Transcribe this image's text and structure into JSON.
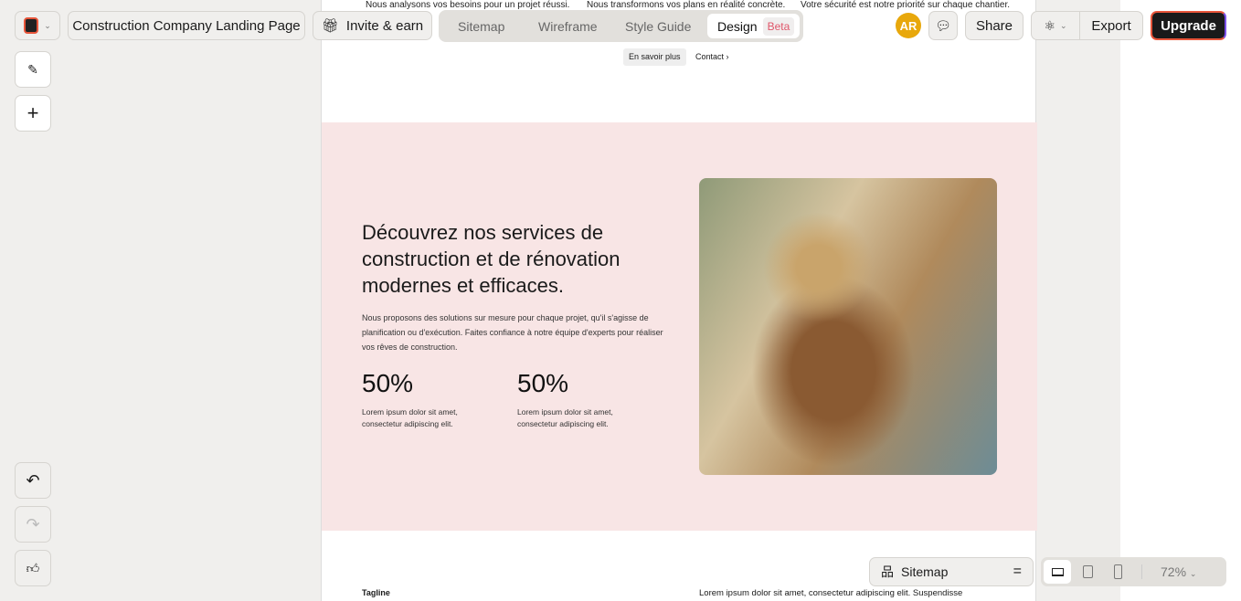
{
  "toolbar": {
    "project_title": "Construction Company Landing Page",
    "invite": "Invite & earn",
    "tabs": [
      "Sitemap",
      "Wireframe",
      "Style Guide",
      "Design"
    ],
    "beta": "Beta",
    "avatar": "AR",
    "share": "Share",
    "export": "Export",
    "upgrade": "Upgrade"
  },
  "page": {
    "top_texts": [
      "Nous analysons vos besoins pour un projet réussi.",
      "Nous transformons vos plans en réalité concrète.",
      "Votre sécurité est notre priorité sur chaque chantier."
    ],
    "nav": {
      "learn_more": "En savoir plus",
      "contact": "Contact"
    },
    "hero": {
      "title": "Découvrez nos services de construction et de rénovation modernes et efficaces.",
      "body": "Nous proposons des solutions sur mesure pour chaque projet, qu'il s'agisse de planification ou d'exécution. Faites confiance à notre équipe d'experts pour réaliser vos rêves de construction.",
      "stats": [
        {
          "value": "50%",
          "desc": "Lorem ipsum dolor sit amet, consectetur adipiscing elit."
        },
        {
          "value": "50%",
          "desc": "Lorem ipsum dolor sit amet, consectetur adipiscing elit."
        }
      ]
    },
    "next": {
      "tagline": "Tagline",
      "text": "Lorem ipsum dolor sit amet, consectetur adipiscing elit. Suspendisse"
    }
  },
  "bottom": {
    "sitemap": "Sitemap",
    "zoom": "72%"
  },
  "colors": {
    "avatar": "#e8a80c",
    "hero_bg": "#f8e5e5"
  }
}
